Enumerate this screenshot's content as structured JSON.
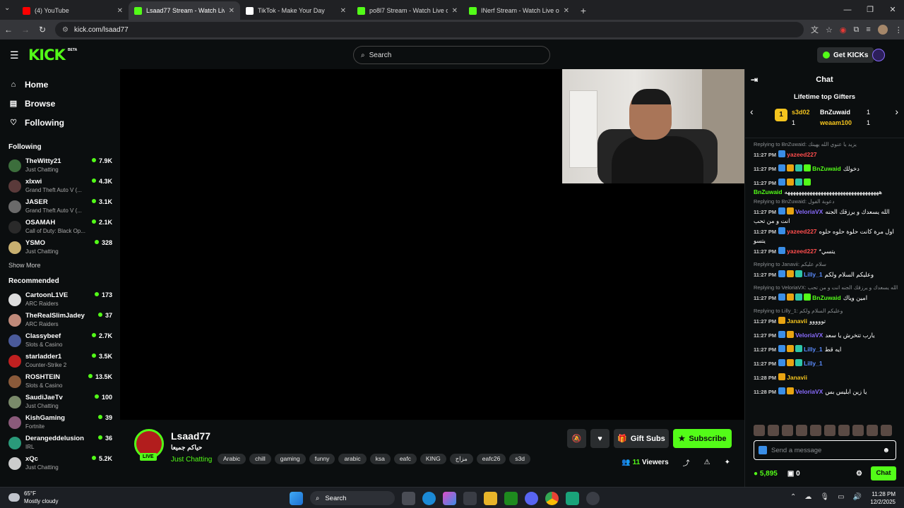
{
  "browser": {
    "tabs": [
      {
        "title": "(4) YouTube",
        "favicon_color": "#ff0000",
        "active": false
      },
      {
        "title": "Lsaad77 Stream - Watch Live o",
        "favicon_color": "#53fc18",
        "active": true
      },
      {
        "title": "TikTok - Make Your Day",
        "favicon_color": "#ffffff",
        "active": false
      },
      {
        "title": "po8l7 Stream - Watch Live on K",
        "favicon_color": "#53fc18",
        "active": false
      },
      {
        "title": "INerf Stream - Watch Live on K",
        "favicon_color": "#53fc18",
        "active": false
      }
    ],
    "url": "kick.com/lsaad77"
  },
  "header": {
    "logo": "KICK",
    "beta": "BETA",
    "search_placeholder": "Search",
    "get_kicks": "Get KICKs"
  },
  "sidebar": {
    "nav": [
      {
        "label": "Home",
        "icon": "home-icon"
      },
      {
        "label": "Browse",
        "icon": "browse-icon"
      },
      {
        "label": "Following",
        "icon": "heart-icon"
      }
    ],
    "following_title": "Following",
    "following": [
      {
        "name": "TheWitty21",
        "category": "Just Chatting",
        "viewers": "7.9K",
        "color": "#3c6e3c"
      },
      {
        "name": "xIxwi",
        "category": "Grand Theft Auto V (...",
        "viewers": "4.3K",
        "color": "#5a3a3a"
      },
      {
        "name": "JASER",
        "category": "Grand Theft Auto V (...",
        "viewers": "3.1K",
        "color": "#6a6a6a"
      },
      {
        "name": "OSAMAH",
        "category": "Call of Duty: Black Op...",
        "viewers": "2.1K",
        "color": "#2a2a2a"
      },
      {
        "name": "YSMO",
        "category": "Just Chatting",
        "viewers": "328",
        "color": "#c8b070"
      }
    ],
    "show_more": "Show More",
    "recommended_title": "Recommended",
    "recommended": [
      {
        "name": "CartoonL1VE",
        "category": "ARC Raiders",
        "viewers": "173",
        "color": "#dddddd"
      },
      {
        "name": "TheRealSlimJadey",
        "category": "ARC Raiders",
        "viewers": "37",
        "color": "#c08a7a"
      },
      {
        "name": "Classybeef",
        "category": "Slots & Casino",
        "viewers": "2.7K",
        "color": "#4a5a9a"
      },
      {
        "name": "starladder1",
        "category": "Counter-Strike 2",
        "viewers": "3.5K",
        "color": "#c02020"
      },
      {
        "name": "ROSHTEIN",
        "category": "Slots & Casino",
        "viewers": "13.5K",
        "color": "#8a5a3a"
      },
      {
        "name": "SaudiJaeTv",
        "category": "Just Chatting",
        "viewers": "100",
        "color": "#7a8a6a"
      },
      {
        "name": "KishGaming",
        "category": "Fortnite",
        "viewers": "39",
        "color": "#8a5a7a"
      },
      {
        "name": "Derangeddelusion",
        "category": "IRL",
        "viewers": "36",
        "color": "#2a9a7a"
      },
      {
        "name": "xQc",
        "category": "Just Chatting",
        "viewers": "5.2K",
        "color": "#cccccc"
      }
    ]
  },
  "channel": {
    "name": "Lsaad77",
    "title": "حياكم جميعا",
    "category": "Just Chatting",
    "live": "LIVE",
    "tags": [
      "Arabic",
      "chill",
      "gaming",
      "funny",
      "arabic",
      "ksa",
      "eafc",
      "KING",
      "مزاج",
      "eafc26",
      "s3d"
    ],
    "gift_subs": "Gift Subs",
    "subscribe": "Subscribe",
    "viewers": "11",
    "viewers_label": "Viewers"
  },
  "chat": {
    "title": "Chat",
    "top_gifters_title": "Lifetime top Gifters",
    "gifters": [
      {
        "rank": "1",
        "name": "s3d02",
        "count": "1",
        "color": "#f4c41e"
      },
      {
        "name": "BnZuwaid",
        "count": "1",
        "color": "#ffffff"
      },
      {
        "name": "weaam100",
        "count": "1",
        "color": "#f4c41e"
      }
    ],
    "messages": [
      {
        "reply": "Replying to BnZuwaid: يزيد يا عنوي الله يهينك",
        "time": "11:27 PM",
        "user": "yazeed227",
        "color": "#ff4d4d",
        "text": "",
        "badges": [
          "b-blue"
        ]
      },
      {
        "time": "11:27 PM",
        "user": "BnZuwaid",
        "color": "#53fc18",
        "text": "دخولك",
        "badges": [
          "b-blue",
          "b-gold",
          "b-teal",
          "b-green"
        ]
      },
      {
        "time": "11:27 PM",
        "user": "BnZuwaid",
        "color": "#53fc18",
        "text": "ههههههههههههههههههههههههههههههههههه",
        "badges": [
          "b-blue",
          "b-gold",
          "b-teal",
          "b-green"
        ]
      },
      {
        "reply": "Replying to BnZuwaid: دعوبة الفول",
        "time": "11:27 PM",
        "user": "VeloriaVX",
        "color": "#8a6cff",
        "text": "الله يسعدك و يرزقك الجنه انت و من تحب",
        "badges": [
          "b-blue",
          "b-gold"
        ]
      },
      {
        "time": "11:27 PM",
        "user": "yazeed227",
        "color": "#ff4d4d",
        "text": "اول مرة كانت حلوة حلوه حلوه يتسو",
        "badges": [
          "b-blue"
        ]
      },
      {
        "time": "11:27 PM",
        "user": "yazeed227",
        "color": "#ff4d4d",
        "text": "*يتسي",
        "badges": [
          "b-blue"
        ]
      },
      {
        "reply": "Replying to Janavii: سلام عليكم",
        "time": "11:27 PM",
        "user": "Lilly_1",
        "color": "#5a8cff",
        "text": "وعليكم السلام ولكم",
        "badges": [
          "b-blue",
          "b-gold",
          "b-teal"
        ]
      },
      {
        "reply": "Replying to VeloriaVX: الله يسعدك و يرزقك الجنه انت و من تحب",
        "time": "11:27 PM",
        "user": "BnZuwaid",
        "color": "#53fc18",
        "text": "امين وياك",
        "badges": [
          "b-blue",
          "b-gold",
          "b-teal",
          "b-green"
        ]
      },
      {
        "reply": "Replying to Lilly_1: وعليكم السلام ولكم",
        "time": "11:27 PM",
        "user": "Janavii",
        "color": "#f4c41e",
        "text": "تووووو",
        "badges": [
          "b-gold"
        ]
      },
      {
        "time": "11:27 PM",
        "user": "VeloriaVX",
        "color": "#8a6cff",
        "text": "يارب تتخرش يا سعد",
        "badges": [
          "b-blue",
          "b-gold"
        ]
      },
      {
        "time": "11:27 PM",
        "user": "Lilly_1",
        "color": "#5a8cff",
        "text": "ايه قط",
        "badges": [
          "b-blue",
          "b-gold",
          "b-teal"
        ]
      },
      {
        "time": "11:27 PM",
        "user": "Lilly_1",
        "color": "#5a8cff",
        "text": "",
        "badges": [
          "b-blue",
          "b-gold",
          "b-teal"
        ]
      },
      {
        "time": "11:28 PM",
        "user": "Janavii",
        "color": "#f4c41e",
        "text": "",
        "badges": [
          "b-gold"
        ]
      },
      {
        "time": "11:28 PM",
        "user": "VeloriaVX",
        "color": "#8a6cff",
        "text": "يا زين ابليس بس",
        "badges": [
          "b-blue",
          "b-gold"
        ]
      }
    ],
    "input_placeholder": "Send a message",
    "kicks_balance": "5,895",
    "gift_count": "0",
    "send_label": "Chat"
  },
  "taskbar": {
    "temp": "65°F",
    "weather": "Mostly cloudy",
    "search": "Search",
    "time": "11:28 PM",
    "date": "12/2/2025"
  }
}
